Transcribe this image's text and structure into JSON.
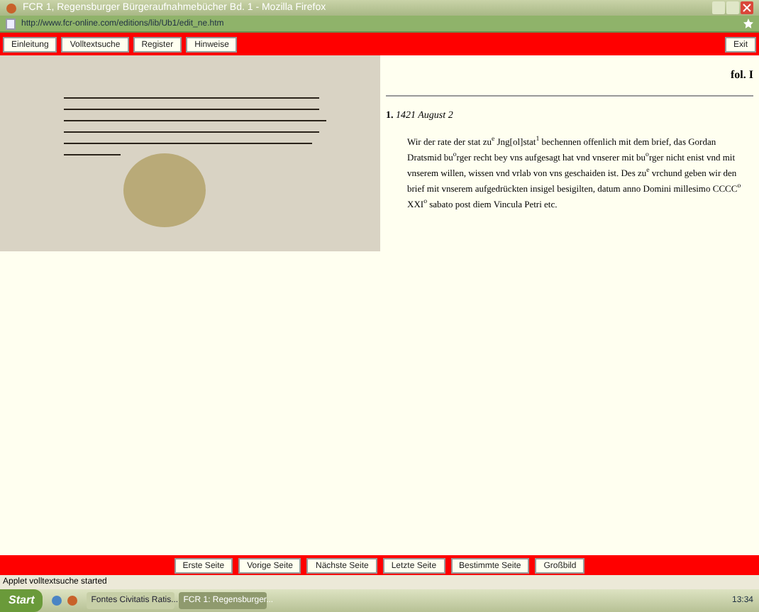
{
  "window": {
    "title": "FCR 1, Regensburger Bürgeraufnahmebücher Bd. 1 - Mozilla Firefox"
  },
  "address_bar": {
    "url": "http://www.fcr-online.com/editions/lib/Ub1/edit_ne.htm"
  },
  "toolbar": {
    "buttons": [
      "Einleitung",
      "Volltextsuche",
      "Register",
      "Hinweise"
    ],
    "exit": "Exit"
  },
  "document": {
    "folio": "fol. I",
    "entry_number": "1.",
    "date": "1421 August 2",
    "text": "Wir der rate der stat zu$^{e}$ Jng[ol]stat$^{1}$ bechennen offenlich mit dem brief, das Gordan Dratsmid bu$^{o}$rger recht bey vns aufgesagt hat vnd vnserer mit bu$^{o}$rger nicht enist vnd mit vnserem willen, wissen vnd vrlab von vns geschaiden ist. Des zu$^{e}$ vrchund geben wir den brief mit vnserem aufgedrückten insigel besigilten, datum anno Domini millesimo CCCC$^{o}$ XXI$^{o}$ sabato post diem Vincula Petri etc."
  },
  "navigation": [
    "Erste Seite",
    "Vorige Seite",
    "Nächste Seite",
    "Letzte Seite",
    "Bestimmte Seite",
    "Großbild"
  ],
  "status_bar": "Applet volltextsuche started",
  "taskbar": {
    "start": "Start",
    "tasks": [
      {
        "label": "Fontes Civitatis Ratis...",
        "selected": false
      },
      {
        "label": "FCR 1: Regensburger...",
        "selected": true
      }
    ],
    "clock": "13:34"
  }
}
